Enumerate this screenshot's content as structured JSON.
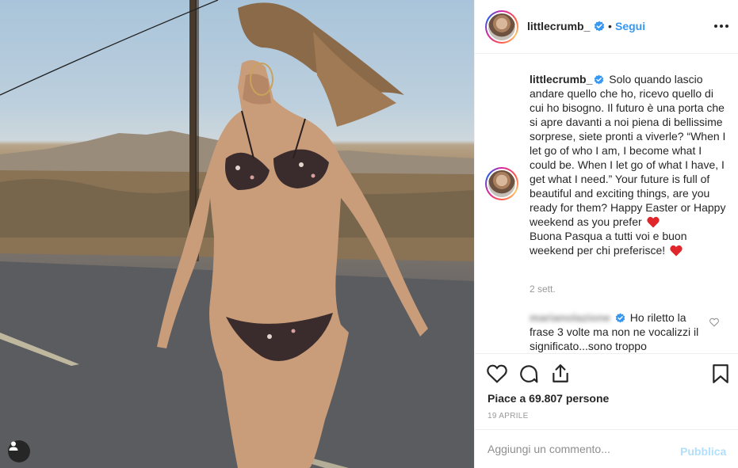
{
  "post": {
    "photo_icon": "user-tag-icon"
  },
  "header": {
    "username": "littlecrumb_",
    "separator": "•",
    "follow_label": "Segui",
    "more_icon": "more-options-icon"
  },
  "caption": {
    "username": "littlecrumb_",
    "lines": [
      "Solo quando lascio andare quello che ho, ricevo quello di cui ho bisogno. Il futuro è una porta che si apre davanti a noi piena di bellissime sorprese, siete pronti a viverle? “When I let go of who I am, I become what I could be. When I let go of what I have, I get what I need.” Your future is full of beautiful and exciting things, are you ready for them? Happy Easter or Happy weekend as you prefer",
      "Buona Pasqua a tutti voi e buon weekend per chi preferisce!"
    ],
    "time_ago": "2 sett."
  },
  "reply": {
    "username": "marianolazione",
    "text": "Ho riletto la frase 3 volte ma non ne vocalizzi il significato...sono troppo"
  },
  "actions": {
    "likes_text": "Piace a 69.807 persone",
    "date": "19 APRILE"
  },
  "composer": {
    "placeholder": "Aggiungi un commento...",
    "post_label": "Pubblica"
  },
  "colors": {
    "accent": "#3897f0",
    "post_disabled": "#b2dffc",
    "heart": "#ed4956"
  }
}
